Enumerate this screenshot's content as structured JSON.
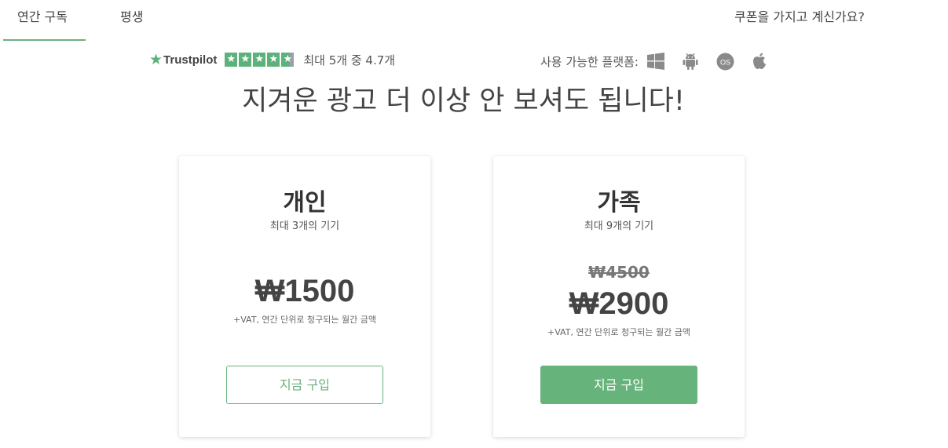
{
  "tabs": [
    {
      "label": "연간 구독",
      "active": true
    },
    {
      "label": "평생",
      "active": false
    }
  ],
  "coupon_link": "쿠폰을 가지고 계신가요?",
  "trustpilot": {
    "brand": "Trustpilot",
    "rating_text": "최대 5개 중 4.7개",
    "stars": 4.7
  },
  "platforms": {
    "label": "사용 가능한 플랫폼:",
    "icons": [
      "windows-icon",
      "android-icon",
      "macos-icon",
      "apple-icon"
    ],
    "macos_text": "OS"
  },
  "headline": "지겨운 광고 더 이상 안 보셔도 됩니다!",
  "plans": [
    {
      "title": "개인",
      "devices": "최대 3개의 기기",
      "price": "₩1500",
      "vat_note": "+VAT, 연간 단위로 청구되는 월간 금액",
      "button": "지금 구입"
    },
    {
      "title": "가족",
      "devices": "최대 9개의 기기",
      "old_price": "₩4500",
      "price": "₩2900",
      "vat_note": "+VAT, 연간 단위로 청구되는 월간 금액",
      "button": "지금 구입"
    }
  ],
  "colors": {
    "accent": "#66b47c",
    "text": "#444444",
    "icon_gray": "#8a8a8a"
  }
}
